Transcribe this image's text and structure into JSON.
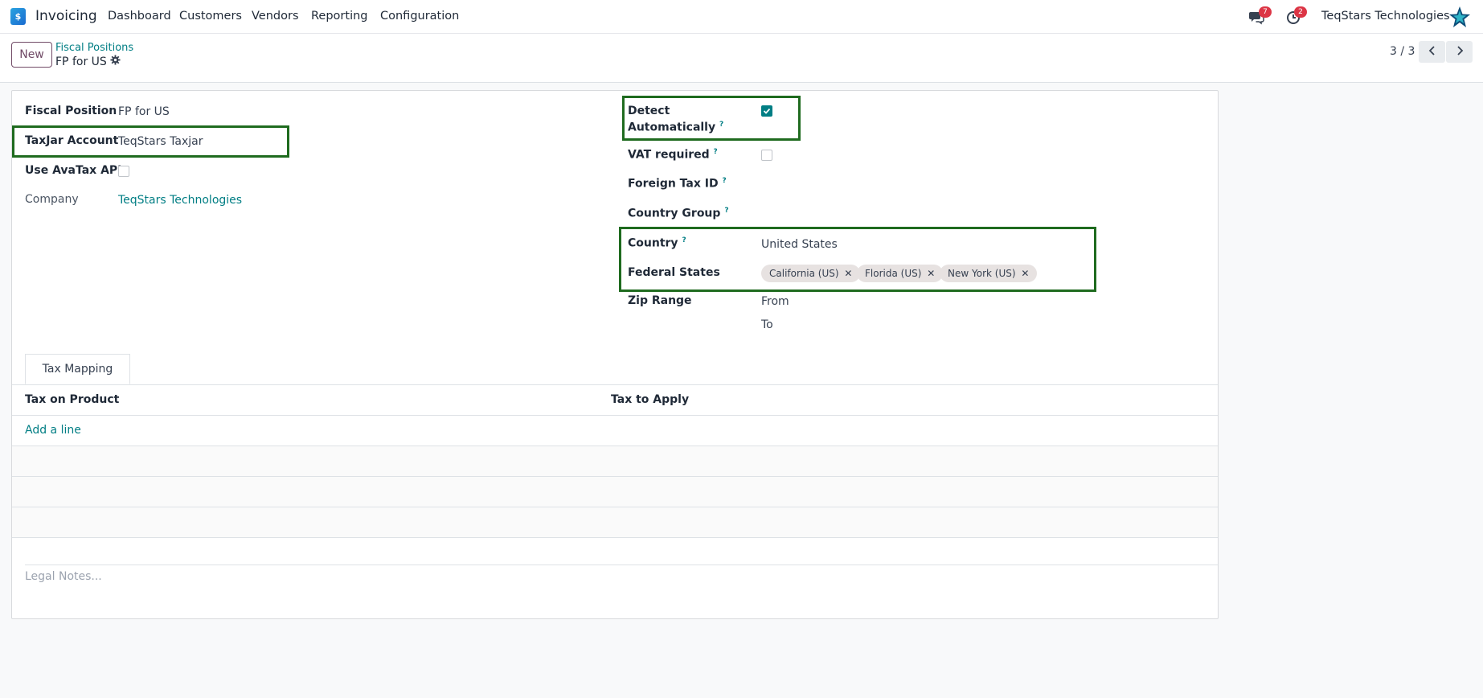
{
  "app": {
    "name": "Invoicing",
    "icon_letter": "$",
    "menu": [
      "Dashboard",
      "Customers",
      "Vendors",
      "Reporting",
      "Configuration"
    ],
    "messages_count": "7",
    "activities_count": "2",
    "company": "TeqStars Technologies"
  },
  "control": {
    "new_label": "New",
    "breadcrumb_parent": "Fiscal Positions",
    "breadcrumb_current": "FP for US",
    "pager": "3 / 3"
  },
  "form": {
    "fiscal_position_label": "Fiscal Position",
    "fiscal_position_value": "FP for US",
    "taxjar_label": "TaxJar Account",
    "taxjar_value": "TeqStars Taxjar",
    "avatax_label": "Use AvaTax API",
    "avatax_checked": false,
    "company_label": "Company",
    "company_value": "TeqStars Technologies",
    "detect_label_line1": "Detect",
    "detect_label_line2": "Automatically",
    "detect_checked": true,
    "vat_label": "VAT required",
    "vat_checked": false,
    "foreign_tax_label": "Foreign Tax ID",
    "country_group_label": "Country Group",
    "country_label": "Country",
    "country_value": "United States",
    "federal_states_label": "Federal States",
    "federal_states": [
      "California (US)",
      "Florida (US)",
      "New York (US)"
    ],
    "zip_label": "Zip Range",
    "zip_from": "From",
    "zip_to": "To",
    "help_mark": "?"
  },
  "tabs": [
    {
      "label": "Tax Mapping",
      "active": true
    }
  ],
  "tax_mapping": {
    "columns": [
      "Tax on Product",
      "Tax to Apply"
    ],
    "add_line": "Add a line",
    "rows": []
  },
  "notes_placeholder": "Legal Notes...",
  "colors": {
    "accent": "#017e84",
    "brand": "#714B67",
    "highlight": "#1f6b1f",
    "badge": "#dc3545"
  }
}
